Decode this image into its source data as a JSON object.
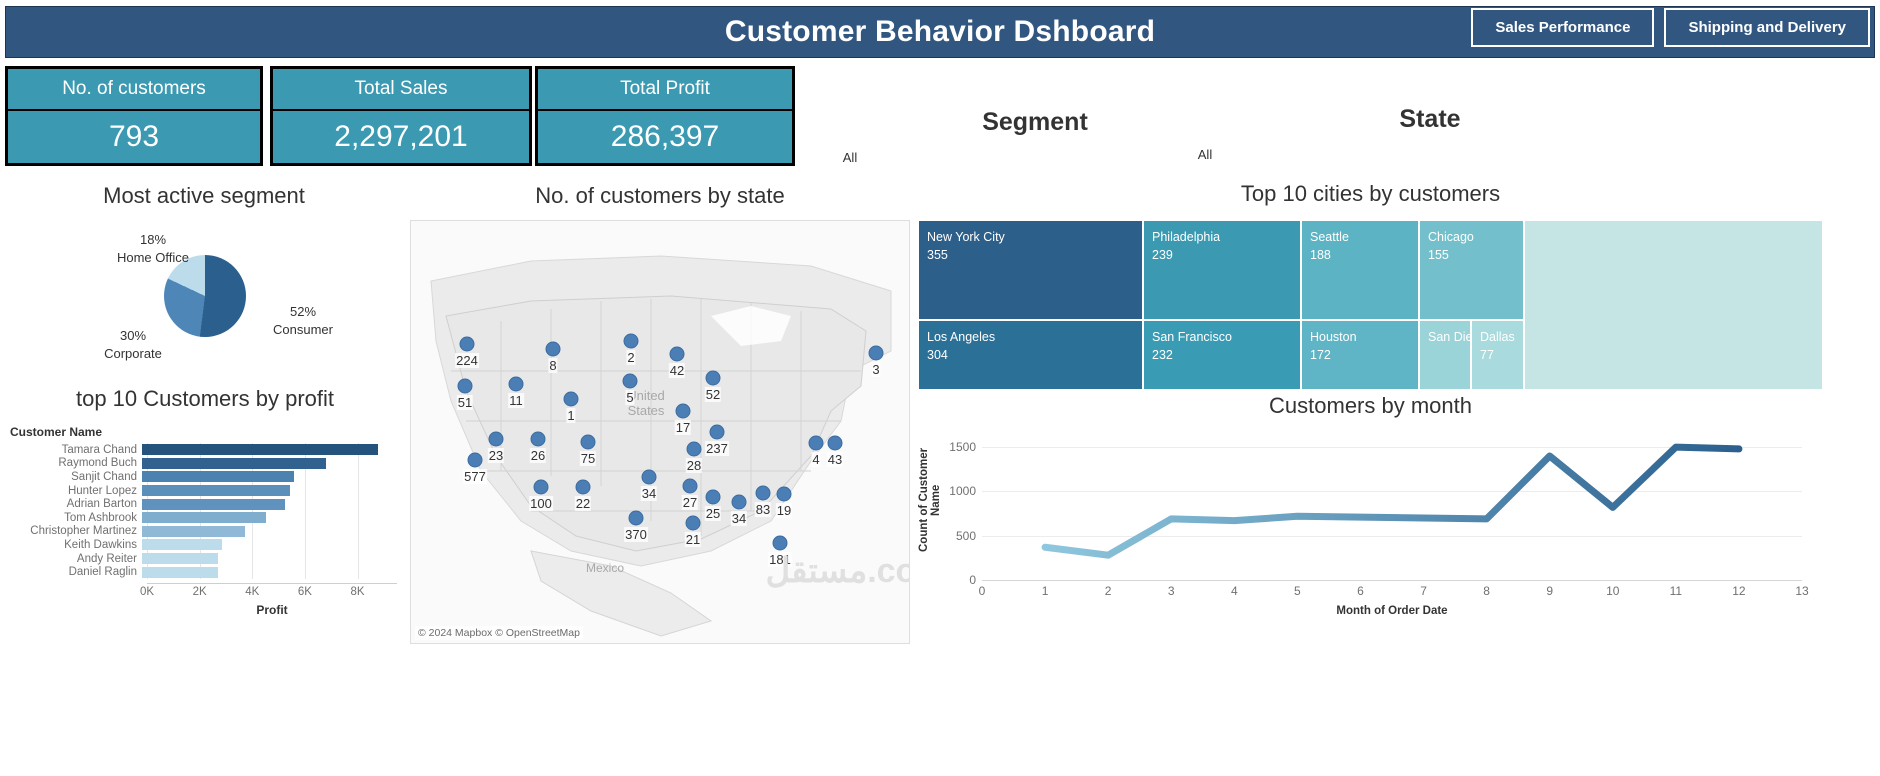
{
  "header": {
    "title": "Customer Behavior Dshboard",
    "buttons": [
      {
        "label": "Sales Performance"
      },
      {
        "label": "Shipping and Delivery"
      }
    ],
    "bg_color": "#31567f"
  },
  "kpis": [
    {
      "label": "No. of customers",
      "value": "793"
    },
    {
      "label": "Total Sales",
      "value": "2,297,201"
    },
    {
      "label": "Total Profit",
      "value": "286,397"
    }
  ],
  "filters": [
    {
      "title": "Segment",
      "value": "All"
    },
    {
      "title": "State",
      "value": "All"
    }
  ],
  "panels": {
    "pie_title": "Most active segment",
    "map_title": "No. of customers by state",
    "tree_title": "Top 10 cities by customers",
    "bar_title": "top 10 Customers by profit",
    "line_title": "Customers by month"
  },
  "chart_data": [
    {
      "type": "pie",
      "title": "Most active segment",
      "categories": [
        "Consumer",
        "Corporate",
        "Home Office"
      ],
      "values": [
        52,
        30,
        18
      ],
      "labels": [
        "52%",
        "30%",
        "18%"
      ],
      "colors": [
        "#2b5f8e",
        "#4f86b8",
        "#bcdcec"
      ],
      "legend": "labels-outside"
    },
    {
      "type": "bar",
      "title": "top 10 Customers by profit",
      "orientation": "horizontal",
      "axis_title": "Customer Name",
      "xlabel": "Profit",
      "ylabel": "",
      "xlim": [
        0,
        9500
      ],
      "xticks": [
        "0K",
        "2K",
        "4K",
        "6K",
        "8K"
      ],
      "xtick_values": [
        0,
        2000,
        4000,
        6000,
        8000
      ],
      "grid": true,
      "categories": [
        "Tamara Chand",
        "Raymond Buch",
        "Sanjit Chand",
        "Hunter Lopez",
        "Adrian Barton",
        "Tom Ashbrook",
        "Christopher Martinez",
        "Keith Dawkins",
        "Andy Reiter",
        "Daniel Raglin"
      ],
      "values": [
        8981,
        6976,
        5757,
        5623,
        5444,
        4703,
        3900,
        3038,
        2885,
        2884
      ],
      "colors": [
        "#24537d",
        "#31628f",
        "#4b82b0",
        "#5c8fba",
        "#5f92bc",
        "#7fadcd",
        "#8fb9d6",
        "#bcdcec",
        "#bcdcec",
        "#bcdcec"
      ]
    },
    {
      "type": "treemap",
      "title": "Top 10 cities by customers",
      "labels": [
        "New York City",
        "Los Angeles",
        "Philadelphia",
        "San Francisco",
        "Seattle",
        "Houston",
        "Chicago",
        "San Diego",
        "Dallas"
      ],
      "values": [
        355,
        304,
        239,
        232,
        188,
        172,
        155,
        null,
        77
      ],
      "tiles": [
        {
          "name": "New York City",
          "value": "355",
          "color": "#2c5f8a"
        },
        {
          "name": "Los Angeles",
          "value": "304",
          "color": "#2b7096"
        },
        {
          "name": "Philadelphia",
          "value": "239",
          "color": "#3b9ab2"
        },
        {
          "name": "San Francisco",
          "value": "232",
          "color": "#3a9cb4"
        },
        {
          "name": "Seattle",
          "value": "188",
          "color": "#5cb3c3"
        },
        {
          "name": "Houston",
          "value": "172",
          "color": "#5fb5c5"
        },
        {
          "name": "Chicago",
          "value": "155",
          "color": "#73c0cc"
        },
        {
          "name": "San Diego",
          "value": "",
          "color": "#9ad3d8"
        },
        {
          "name": "Dallas",
          "value": "77",
          "color": "#a8dade"
        },
        {
          "name": "",
          "value": "",
          "color": "#c5e5e4"
        }
      ]
    },
    {
      "type": "line",
      "title": "Customers by month",
      "xlabel": "Month of Order Date",
      "ylabel": "Count of Customer Name",
      "xlim": [
        0,
        13
      ],
      "ylim": [
        0,
        1750
      ],
      "yticks": [
        "0",
        "500",
        "1000",
        "1500"
      ],
      "ytick_values": [
        0,
        500,
        1000,
        1500
      ],
      "xticks": [
        "0",
        "1",
        "2",
        "3",
        "4",
        "5",
        "6",
        "7",
        "8",
        "9",
        "10",
        "11",
        "12",
        "13"
      ],
      "grid": true,
      "x": [
        1,
        2,
        3,
        4,
        5,
        6,
        7,
        8,
        9,
        10,
        11,
        12
      ],
      "values": [
        370,
        280,
        690,
        670,
        720,
        710,
        700,
        690,
        1400,
        820,
        1500,
        1480
      ],
      "line_color_start": "#8fc7de",
      "line_color_end": "#2b5f8e"
    },
    {
      "type": "map",
      "title": "No. of customers by state",
      "attribution": "© 2024 Mapbox © OpenStreetMap",
      "region_labels": [
        "United States",
        "Mexico"
      ],
      "points": [
        {
          "label": "224",
          "x": 56,
          "y": 123
        },
        {
          "label": "8",
          "x": 142,
          "y": 128
        },
        {
          "label": "2",
          "x": 220,
          "y": 120
        },
        {
          "label": "42",
          "x": 266,
          "y": 133
        },
        {
          "label": "3",
          "x": 465,
          "y": 132
        },
        {
          "label": "51",
          "x": 54,
          "y": 165
        },
        {
          "label": "11",
          "x": 105,
          "y": 163
        },
        {
          "label": "5",
          "x": 219,
          "y": 160
        },
        {
          "label": "52",
          "x": 302,
          "y": 157
        },
        {
          "label": "1",
          "x": 160,
          "y": 178
        },
        {
          "label": "17",
          "x": 272,
          "y": 190
        },
        {
          "label": "23",
          "x": 85,
          "y": 218
        },
        {
          "label": "26",
          "x": 127,
          "y": 218
        },
        {
          "label": "75",
          "x": 177,
          "y": 221
        },
        {
          "label": "237",
          "x": 306,
          "y": 211
        },
        {
          "label": "28",
          "x": 283,
          "y": 228
        },
        {
          "label": "4",
          "x": 405,
          "y": 222
        },
        {
          "label": "43",
          "x": 424,
          "y": 222
        },
        {
          "label": "577",
          "x": 64,
          "y": 239
        },
        {
          "label": "100",
          "x": 130,
          "y": 266
        },
        {
          "label": "22",
          "x": 172,
          "y": 266
        },
        {
          "label": "34",
          "x": 238,
          "y": 256
        },
        {
          "label": "27",
          "x": 279,
          "y": 265
        },
        {
          "label": "25",
          "x": 302,
          "y": 276
        },
        {
          "label": "34",
          "x": 328,
          "y": 281
        },
        {
          "label": "83",
          "x": 352,
          "y": 272
        },
        {
          "label": "19",
          "x": 373,
          "y": 273
        },
        {
          "label": "370",
          "x": 225,
          "y": 297
        },
        {
          "label": "21",
          "x": 282,
          "y": 302
        },
        {
          "label": "181",
          "x": 369,
          "y": 322
        }
      ]
    }
  ],
  "watermark": "مستقل.com"
}
